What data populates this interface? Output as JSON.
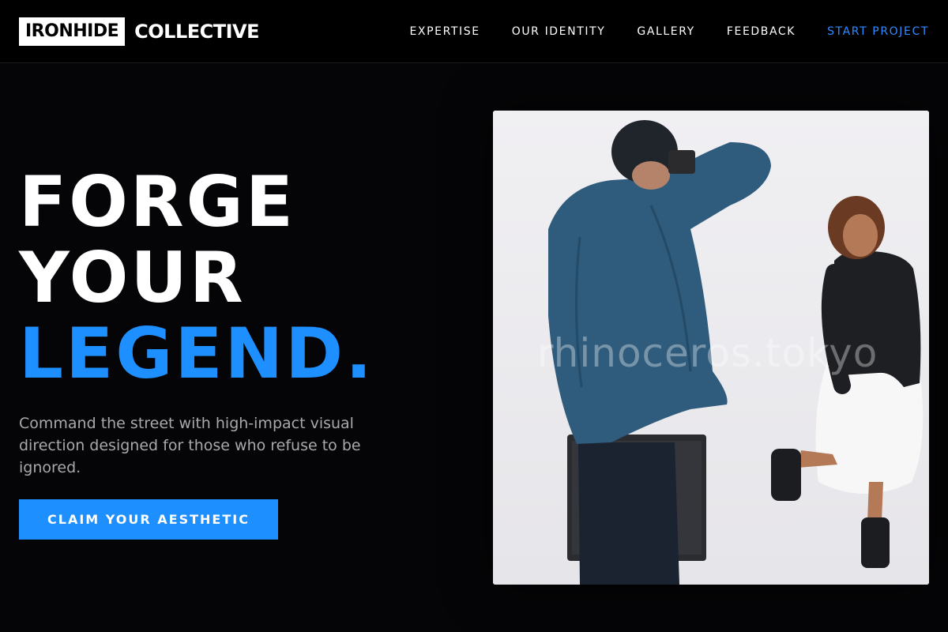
{
  "header": {
    "logo_box": "IRONHIDE",
    "logo_word": "COLLECTIVE",
    "nav": [
      {
        "label": "EXPERTISE"
      },
      {
        "label": "OUR IDENTITY"
      },
      {
        "label": "GALLERY"
      },
      {
        "label": "FEEDBACK"
      },
      {
        "label": "START PROJECT"
      }
    ]
  },
  "hero": {
    "line1": "FORGE",
    "line2": "YOUR",
    "line3": "LEGEND.",
    "subtitle": "Command the street with high-impact visual direction designed for those who refuse to be ignored.",
    "cta_label": "CLAIM YOUR AESTHETIC"
  },
  "photo": {
    "watermark": "rhinoceros.tokyo"
  },
  "colors": {
    "background": "#050507",
    "accent": "#1e8fff",
    "nav_accent": "#2f8bff",
    "muted_text": "#a9a9ad"
  }
}
